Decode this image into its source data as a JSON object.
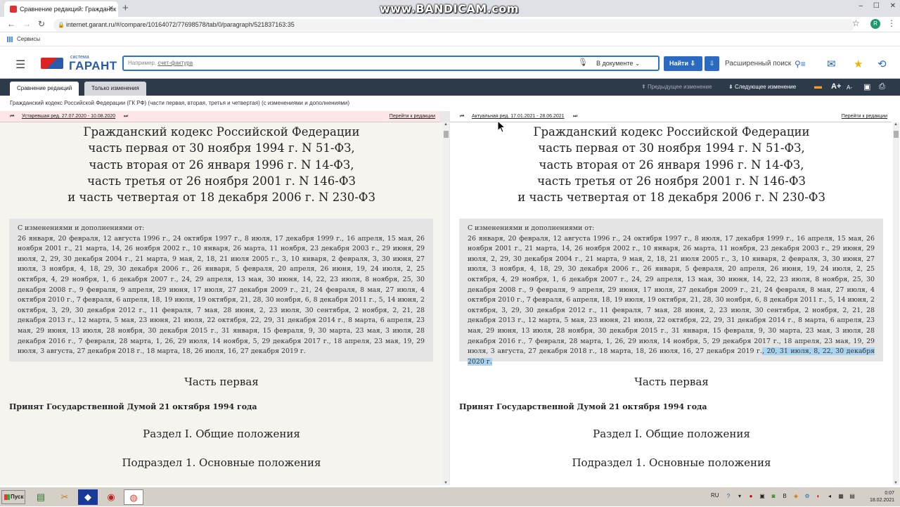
{
  "browser": {
    "tab_title": "Сравнение редакций: Гражданск",
    "url": "internet.garant.ru/#/compare/10164072/77698578/tab/0/paragraph/521837163:35",
    "bookmarks_label": "Сервисы",
    "profile_initial": "R",
    "recorder_watermark": "www.BANDICAM.com"
  },
  "garant": {
    "logo_system": "система",
    "logo_brand": "ГАРАНТ",
    "search_placeholder_prefix": "Например, ",
    "search_placeholder_example": "счет-фактура",
    "search_scope": "В документе",
    "find_button": "Найти",
    "advanced_search": "Расширенный поиск"
  },
  "toolbar": {
    "tab_compare": "Сравнение редакций",
    "tab_changes_only": "Только изменения",
    "prev_change": "Предыдущее изменение",
    "next_change": "Следующее изменение",
    "font_bigger": "A+",
    "font_smaller": "A-"
  },
  "document_title": "Гражданский кодекс Российской Федерации (ГК РФ) (части первая, вторая, третья и четвертая) (с изменениями и дополнениями)",
  "left_pane": {
    "edition_label": "Устаревшая ред. 27.07.2020 - 10.08.2020",
    "goto_label": "Перейти к редакции"
  },
  "right_pane": {
    "edition_label": "Актуальная ред. 17.01.2021 - 28.06.2021",
    "goto_label": "Перейти к редакции"
  },
  "doc": {
    "heading_line1": "Гражданский кодекс Российской Федерации",
    "heading_line2": "часть первая от 30 ноября 1994 г. N 51-ФЗ,",
    "heading_line3": "часть вторая от 26 января 1996 г. N 14-ФЗ,",
    "heading_line4": "часть третья от 26 ноября 2001 г. N 146-ФЗ",
    "heading_line5": "и часть четвертая от 18 декабря 2006 г. N 230-ФЗ",
    "changes_header": "С изменениями и дополнениями от:",
    "changes_text": "26 января, 20 февраля, 12 августа 1996 г., 24 октября 1997 г., 8 июля, 17 декабря 1999 г., 16 апреля, 15 мая, 26 ноября 2001 г., 21 марта, 14, 26 ноября 2002 г., 10 января, 26 марта, 11 ноября, 23 декабря 2003 г., 29 июня, 29 июля, 2, 29, 30 декабря 2004 г., 21 марта, 9 мая, 2, 18, 21 июля 2005 г., 3, 10 января, 2 февраля, 3, 30 июня, 27 июля, 3 ноября, 4, 18, 29, 30 декабря 2006 г., 26 января, 5 февраля, 20 апреля, 26 июня, 19, 24 июля, 2, 25 октября, 4, 29 ноября, 1, 6 декабря 2007 г., 24, 29 апреля, 13 мая, 30 июня, 14, 22, 23 июля, 8 ноября, 25, 30 декабря 2008 г., 9 февраля, 9 апреля, 29 июня, 17 июля, 27 декабря 2009 г., 21, 24 февраля, 8 мая, 27 июля, 4 октября 2010 г., 7 февраля, 6 апреля, 18, 19 июля, 19 октября, 21, 28, 30 ноября, 6, 8 декабря 2011 г., 5, 14 июня, 2 октября, 3, 29, 30 декабря 2012 г., 11 февраля, 7 мая, 28 июня, 2, 23 июля, 30 сентября, 2 ноября, 2, 21, 28 декабря 2013 г., 12 марта, 5 мая, 23 июня, 21 июля, 22 октября, 22, 29, 31 декабря 2014 г., 8 марта, 6 апреля, 23 мая, 29 июня, 13 июля, 28 ноября, 30 декабря 2015 г., 31 января, 15 февраля, 9, 30 марта, 23 мая, 3 июля, 28 декабря 2016 г., 7 февраля, 28 марта, 1, 26, 29 июля, 14 ноября, 5, 29 декабря 2017 г., 18 апреля, 23 мая, 19, 29 июля, 3 августа, 27 декабря 2018 г., 18 марта, 18, 26 июля, 16, 27 декабря 2019 г.",
    "changes_added": ", 20, 31 июля, 8, 22, 30 декабря 2020 г.",
    "part_title": "Часть первая",
    "adopted": "Принят Государственной Думой 21 октября 1994 года",
    "section_title": "Раздел I. Общие положения",
    "subsection_title": "Подраздел 1. Основные положения"
  },
  "taskbar": {
    "start_label": "Пуск",
    "language": "RU",
    "clock_time": "0:07",
    "clock_date": "18.02.2021"
  }
}
